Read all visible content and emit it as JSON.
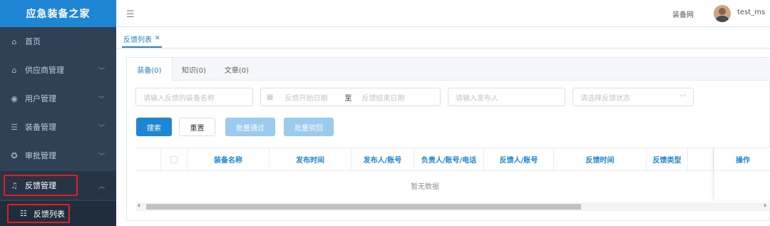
{
  "app": {
    "title": "应急装备之家"
  },
  "sidebar": {
    "items": [
      {
        "label": "首页",
        "icon": "home-icon"
      },
      {
        "label": "供应商管理",
        "icon": "home-icon"
      },
      {
        "label": "用户管理",
        "icon": "user-icon"
      },
      {
        "label": "装备管理",
        "icon": "list-icon"
      },
      {
        "label": "审批管理",
        "icon": "approve-icon"
      },
      {
        "label": "反馈管理",
        "icon": "bell-icon"
      }
    ],
    "sub_item": {
      "label": "反馈列表",
      "icon": "list-icon"
    }
  },
  "header": {
    "site_link": "装备网",
    "username": "test_ms"
  },
  "page_tabs": [
    {
      "label": "反馈列表"
    }
  ],
  "content_tabs": [
    {
      "label": "装备(0)"
    },
    {
      "label": "知识(0)"
    },
    {
      "label": "文章(0)"
    }
  ],
  "filters": {
    "name_placeholder": "请输入反馈的装备名称",
    "start_placeholder": "反馈开始日期",
    "range_sep": "至",
    "end_placeholder": "反馈结束日期",
    "publisher_placeholder": "请输入发布人",
    "status_placeholder": "请选择反馈状态"
  },
  "buttons": {
    "search": "搜索",
    "reset": "重置",
    "batch_approve": "批量通过",
    "batch_reject": "批量驳回"
  },
  "table": {
    "columns": [
      "装备名称",
      "发布时间",
      "发布人/账号",
      "负责人/账号/电话",
      "反馈人/账号",
      "反馈时间",
      "反馈类型",
      "操作"
    ],
    "empty_text": "暂无数据"
  },
  "colors": {
    "accent": "#1f86d6",
    "sidebar_bg": "#304156",
    "highlight": "#e02020"
  }
}
